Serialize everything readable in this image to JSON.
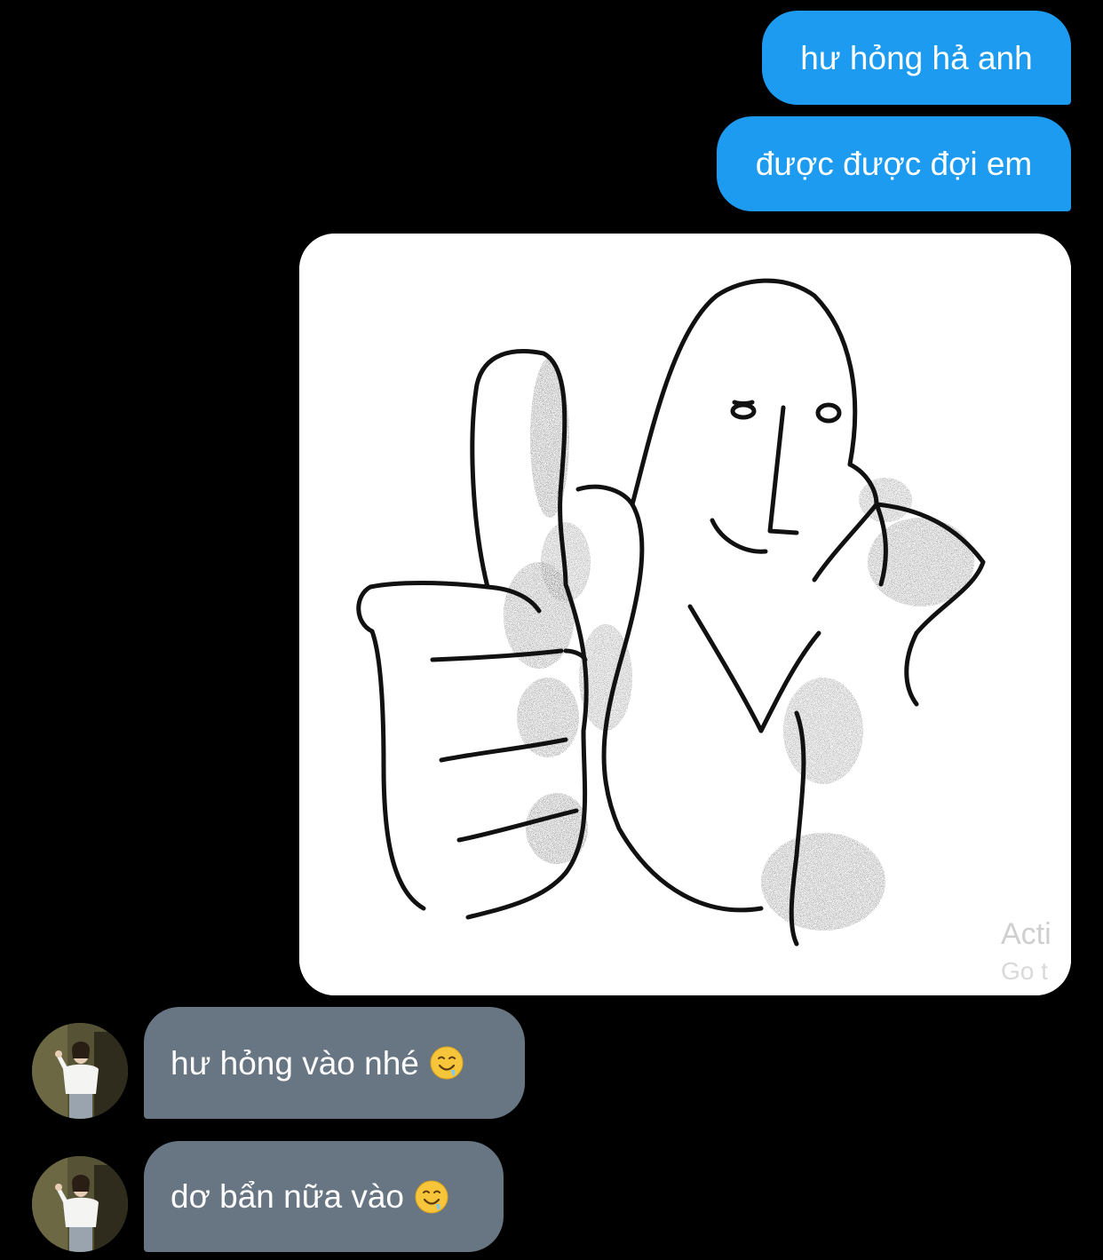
{
  "messages": {
    "outgoing": [
      {
        "text": "hư hỏng hả anh"
      },
      {
        "text": "được được đợi em"
      }
    ],
    "image": {
      "watermark_line1": "Acti",
      "watermark_line2": "Go t"
    },
    "incoming": [
      {
        "text": "hư hỏng vào nhé",
        "emoji": "drooling-face-icon"
      },
      {
        "text": "dơ bẩn nữa vào",
        "emoji": "drooling-face-icon"
      }
    ]
  },
  "colors": {
    "background": "#000000",
    "outgoing_bubble": "#1d9bf0",
    "incoming_bubble": "#687684",
    "text": "#ffffff"
  }
}
